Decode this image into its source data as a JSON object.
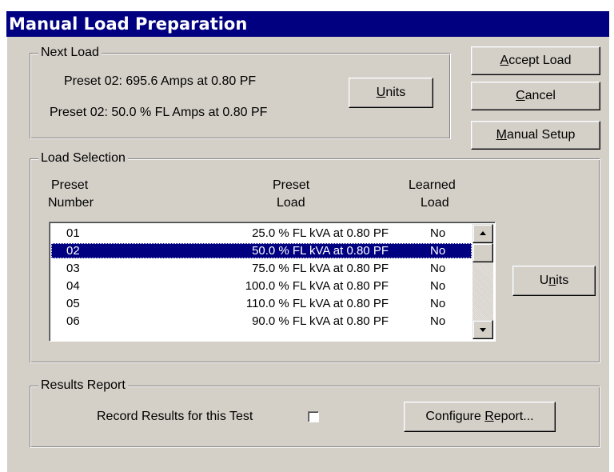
{
  "window": {
    "title": "Manual Load Preparation"
  },
  "next_load": {
    "legend": "Next Load",
    "line1": "Preset 02:   695.6 Amps at 0.80 PF",
    "line2": "Preset 02:   50.0 % FL Amps at 0.80 PF",
    "units_button": {
      "mnemonic": "U",
      "rest": "nits"
    }
  },
  "buttons": {
    "accept": {
      "mnemonic": "A",
      "rest": "ccept Load"
    },
    "cancel": {
      "mnemonic": "C",
      "rest": "ancel"
    },
    "manual_setup": {
      "mnemonic": "M",
      "rest": "anual Setup"
    }
  },
  "load_selection": {
    "legend": "Load Selection",
    "headers": {
      "preset_number": [
        "Preset",
        "Number"
      ],
      "preset_load": [
        "Preset",
        "Load"
      ],
      "learned_load": [
        "Learned",
        "Load"
      ]
    },
    "rows": [
      {
        "number": "01",
        "load": "25.0 %  FL  kVA  at  0.80 PF",
        "learned": "No",
        "selected": false
      },
      {
        "number": "02",
        "load": "50.0 %  FL  kVA  at  0.80 PF",
        "learned": "No",
        "selected": true
      },
      {
        "number": "03",
        "load": "75.0 %  FL  kVA  at  0.80 PF",
        "learned": "No",
        "selected": false
      },
      {
        "number": "04",
        "load": "100.0 %  FL  kVA  at  0.80 PF",
        "learned": "No",
        "selected": false
      },
      {
        "number": "05",
        "load": "110.0 %  FL  kVA  at  0.80 PF",
        "learned": "No",
        "selected": false
      },
      {
        "number": "06",
        "load": "90.0 %  FL  kVA  at  0.80 PF",
        "learned": "No",
        "selected": false
      }
    ],
    "units_button": {
      "before": "U",
      "mnemonic": "n",
      "rest": "its"
    }
  },
  "results_report": {
    "legend": "Results Report",
    "record_label": "Record Results for this Test",
    "record_checked": false,
    "configure_button": {
      "before": "Configure ",
      "mnemonic": "R",
      "rest": "eport..."
    }
  },
  "icons": {
    "scroll_up": "triangle-up",
    "scroll_down": "triangle-down"
  }
}
